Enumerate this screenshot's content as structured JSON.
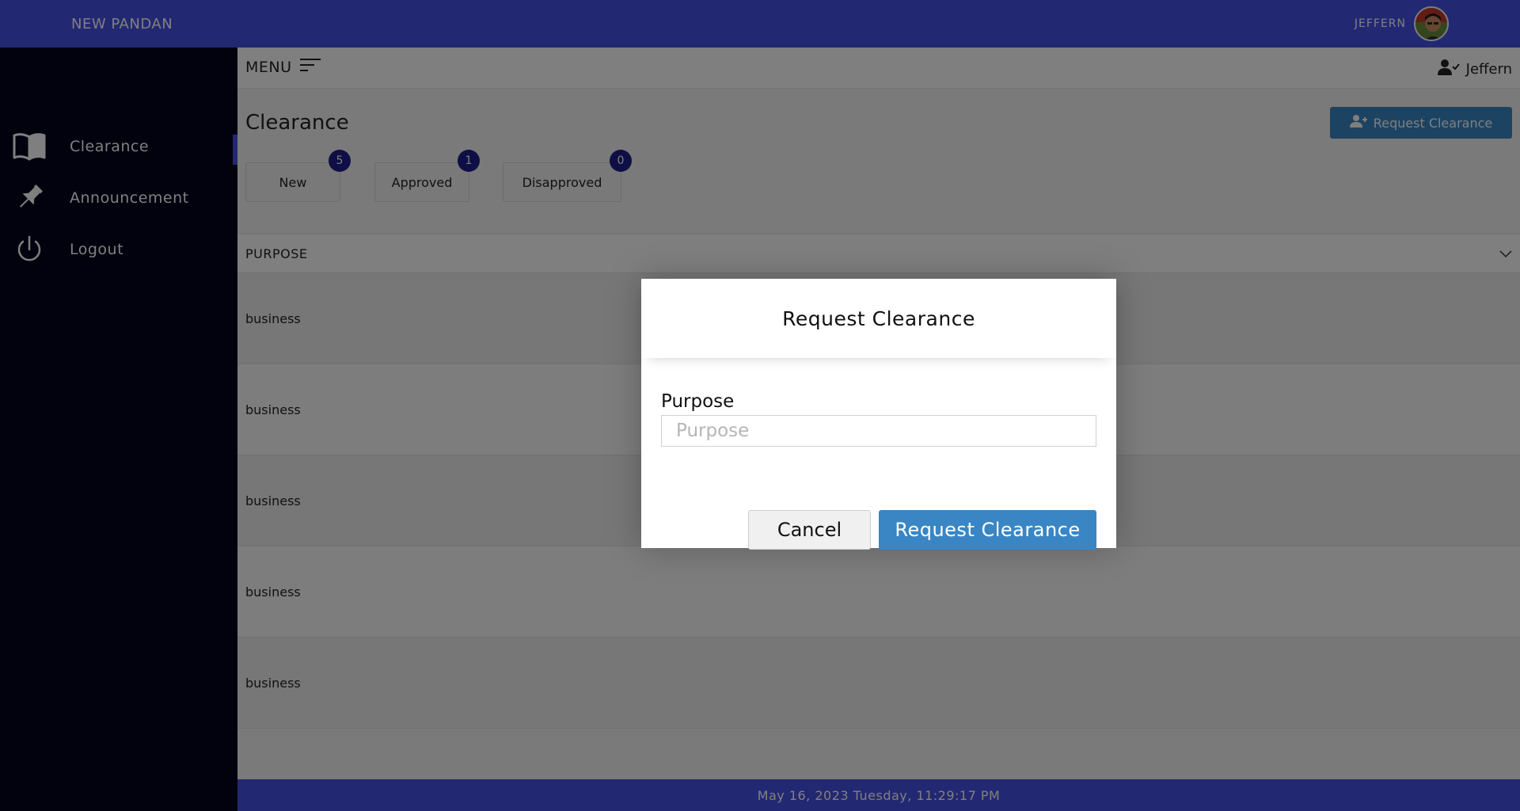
{
  "app": {
    "brand": "NEW PANDAN",
    "user_name_top": "JEFFERN"
  },
  "sidebar": {
    "items": [
      {
        "label": "Clearance",
        "icon": "book-open-icon",
        "active": true
      },
      {
        "label": "Announcement",
        "icon": "pin-icon",
        "active": false
      },
      {
        "label": "Logout",
        "icon": "power-icon",
        "active": false
      }
    ]
  },
  "subbar": {
    "menu_label": "MENU",
    "user_name": "Jeffern"
  },
  "page": {
    "title": "Clearance",
    "request_button_label": "Request Clearance",
    "tabs": [
      {
        "label": "New",
        "count": "5"
      },
      {
        "label": "Approved",
        "count": "1"
      },
      {
        "label": "Disapproved",
        "count": "0"
      }
    ]
  },
  "table": {
    "header": "PURPOSE",
    "rows": [
      "business",
      "business",
      "business",
      "business",
      "business"
    ]
  },
  "footer": {
    "datetime": "May 16, 2023 Tuesday, 11:29:17 PM"
  },
  "modal": {
    "title": "Request Clearance",
    "field_label": "Purpose",
    "field_placeholder": "Purpose",
    "field_value": "",
    "cancel_label": "Cancel",
    "submit_label": "Request Clearance"
  },
  "colors": {
    "accent": "#4751e7",
    "sidebar_bg": "#04041e",
    "primary_button": "#3a86c4",
    "badge": "#1f1f8a"
  }
}
